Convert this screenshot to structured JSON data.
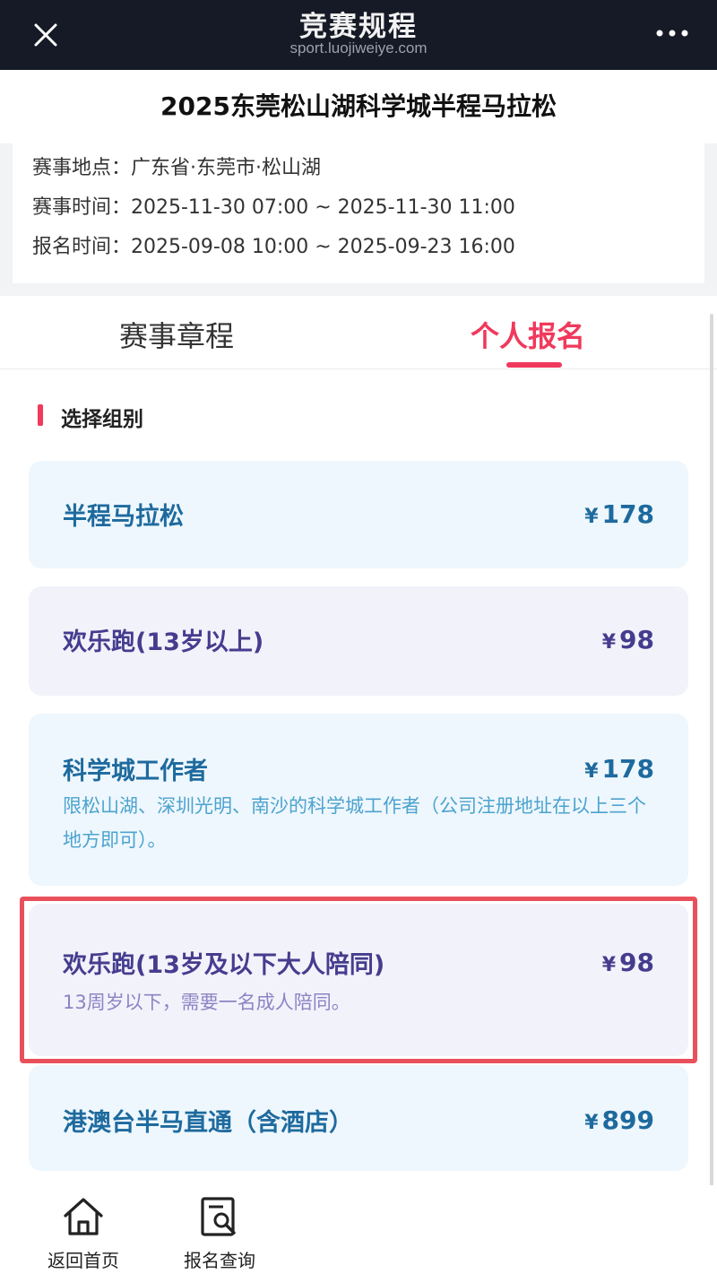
{
  "topbar": {
    "title": "竞赛规程",
    "url": "sport.luojiweiye.com",
    "close_icon": "close-icon",
    "more_icon": "more-icon"
  },
  "event": {
    "title": "2025东莞松山湖科学城半程马拉松",
    "info": [
      {
        "text": "赛事地点：广东省·东莞市·松山湖"
      },
      {
        "text": "赛事时间：2025-11-30 07:00 ~ 2025-11-30 11:00"
      },
      {
        "text": "报名时间：2025-09-08 10:00 ~ 2025-09-23 16:00"
      }
    ]
  },
  "tabs": [
    {
      "label": "赛事章程",
      "active": false
    },
    {
      "label": "个人报名",
      "active": true
    }
  ],
  "section": {
    "title": "选择组别"
  },
  "categories": [
    {
      "name": "半程马拉松",
      "currency": "¥",
      "price": "178",
      "desc": ""
    },
    {
      "name": "欢乐跑(13岁以上)",
      "currency": "¥",
      "price": "98",
      "desc": ""
    },
    {
      "name": "科学城工作者",
      "currency": "¥",
      "price": "178",
      "desc": "限松山湖、深圳光明、南沙的科学城工作者（公司注册地址在以上三个地方即可）。"
    },
    {
      "name": "欢乐跑(13岁及以下大人陪同)",
      "currency": "¥",
      "price": "98",
      "desc": "13周岁以下，需要一名成人陪同。",
      "highlighted": true
    },
    {
      "name": "港澳台半马直通（含酒店）",
      "currency": "¥",
      "price": "899",
      "desc": ""
    }
  ],
  "bottom_nav": [
    {
      "label": "返回首页",
      "icon": "home-icon"
    },
    {
      "label": "报名查询",
      "icon": "search-document-icon"
    }
  ],
  "colors": {
    "accent": "#f0395c",
    "blue_card_text": "#1e6a9e",
    "purple_card_text": "#463c8e",
    "highlight_border": "#e8505b",
    "topbar_bg": "#161a26"
  }
}
